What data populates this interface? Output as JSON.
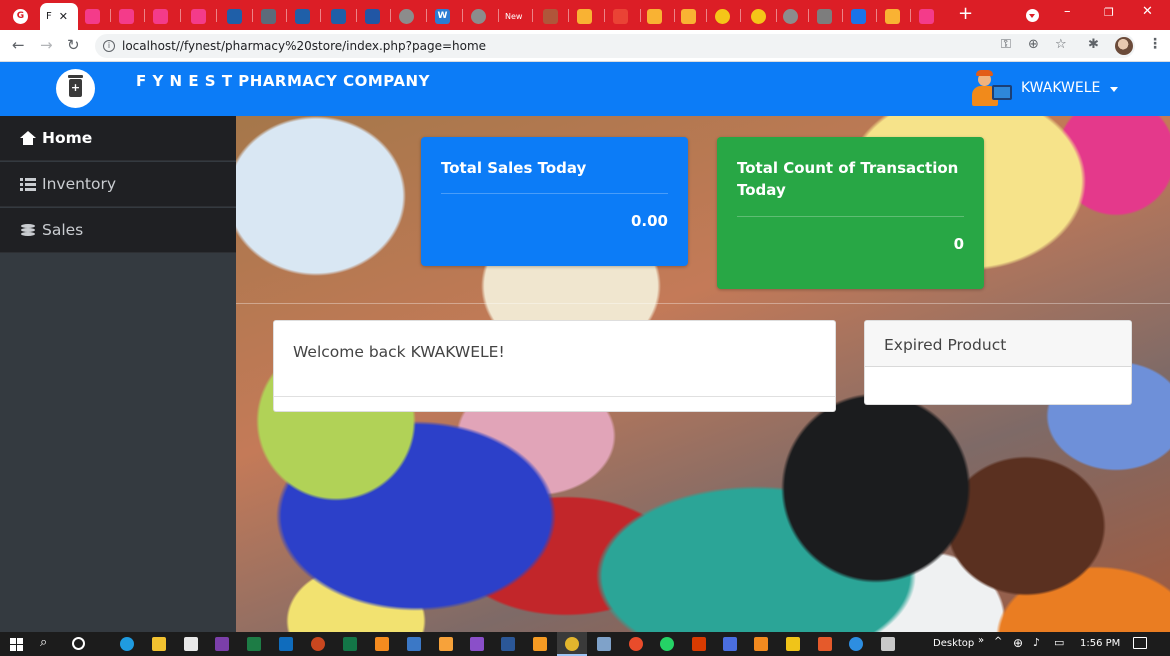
{
  "browser": {
    "active_tab_label": "F",
    "other_tab_label": "New",
    "new_tab_symbol": "+",
    "window_controls": [
      "–",
      "❐",
      "✕"
    ],
    "url": "localhost//fynest/pharmacy%20store/index.php?page=home",
    "colors": {
      "tab_strip": "#dc1e26",
      "omnibox": "#f1f3f4"
    }
  },
  "navbar": {
    "brand": "F Y N E S T PHARMACY COMPANY",
    "user_name": "KWAKWELE",
    "logo_icon": "medicine-bottle-icon",
    "color": "#0c7cf7"
  },
  "sidebar": {
    "items": [
      {
        "label": "Home",
        "icon": "home-icon",
        "active": true
      },
      {
        "label": "Inventory",
        "icon": "list-icon",
        "active": false
      },
      {
        "label": "Sales",
        "icon": "coins-icon",
        "active": false
      }
    ]
  },
  "dashboard": {
    "total_sales": {
      "title": "Total Sales Today",
      "value": "0.00",
      "color": "#0c7cf7"
    },
    "total_transactions": {
      "title": "Total Count of Transaction Today",
      "value": "0",
      "color": "#28a745"
    },
    "welcome": "Welcome back KWAKWELE!",
    "expired_title": "Expired Product"
  },
  "taskbar": {
    "desktop_label": "Desktop",
    "time": "1:56 PM"
  }
}
